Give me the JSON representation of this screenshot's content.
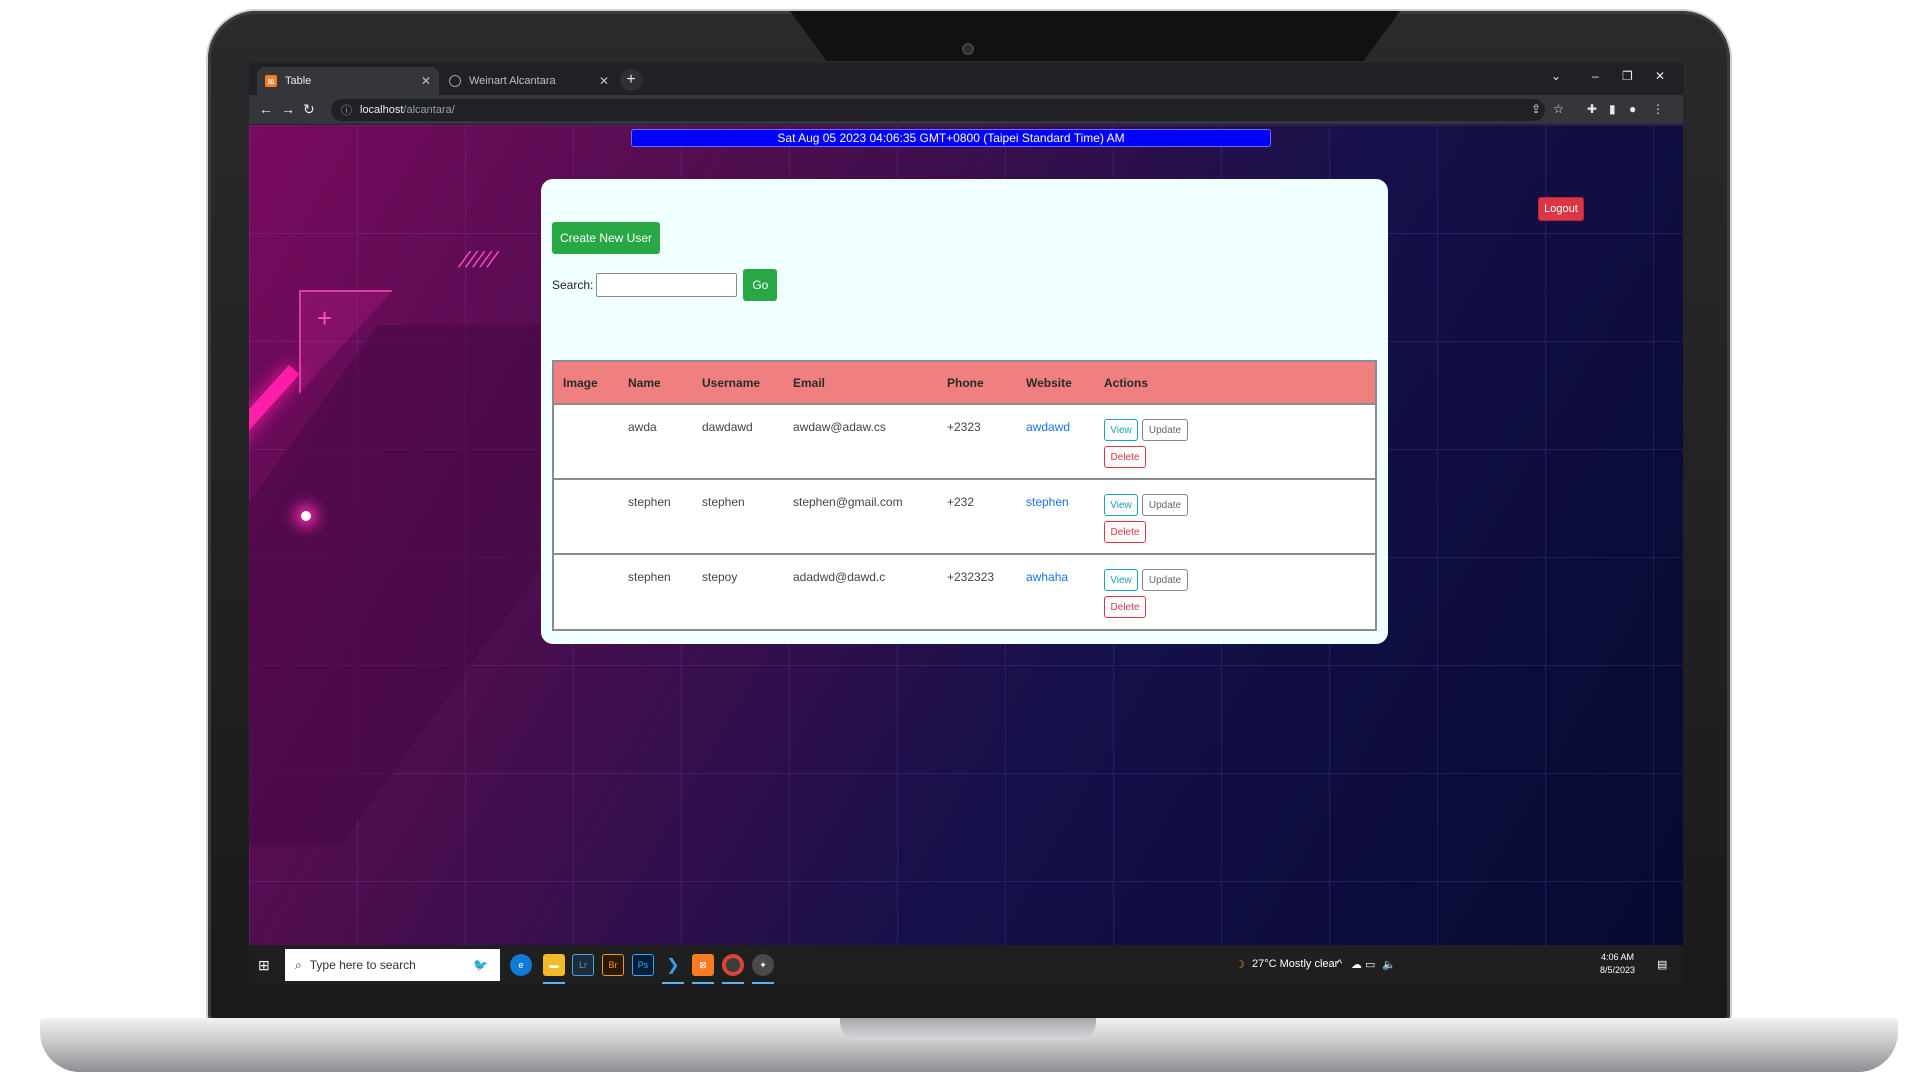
{
  "browser": {
    "tabs": [
      {
        "title": "Table",
        "active": true
      },
      {
        "title": "Weinart Alcantara",
        "active": false
      }
    ],
    "url_host": "localhost",
    "url_path": "/alcantara/"
  },
  "page": {
    "datetime": "Sat Aug 05 2023 04:06:35 GMT+0800 (Taipei Standard Time) AM",
    "logout_label": "Logout",
    "create_label": "Create New User",
    "search_label": "Search:",
    "search_value": "",
    "go_label": "Go",
    "table": {
      "headers": [
        "Image",
        "Name",
        "Username",
        "Email",
        "Phone",
        "Website",
        "Actions"
      ],
      "rows": [
        {
          "image": "",
          "name": "awda",
          "username": "dawdawd",
          "email": "awdaw@adaw.cs",
          "phone": "+2323",
          "website": "awdawd"
        },
        {
          "image": "",
          "name": "stephen",
          "username": "stephen",
          "email": "stephen@gmail.com",
          "phone": "+232",
          "website": "stephen"
        },
        {
          "image": "",
          "name": "stephen",
          "username": "stepoy",
          "email": "adadwd@dawd.c",
          "phone": "+232323",
          "website": "awhaha"
        }
      ],
      "action_labels": {
        "view": "View",
        "update": "Update",
        "delete": "Delete"
      }
    }
  },
  "taskbar": {
    "search_placeholder": "Type here to search",
    "weather": "27°C  Mostly clear",
    "time": "4:06 AM",
    "date": "8/5/2023"
  },
  "colors": {
    "datetime_bg": "#0000ff",
    "panel_bg": "#f0ffff",
    "header_bg": "#f08080",
    "success": "#28a745",
    "danger": "#dc3545",
    "info": "#17a2b8"
  }
}
